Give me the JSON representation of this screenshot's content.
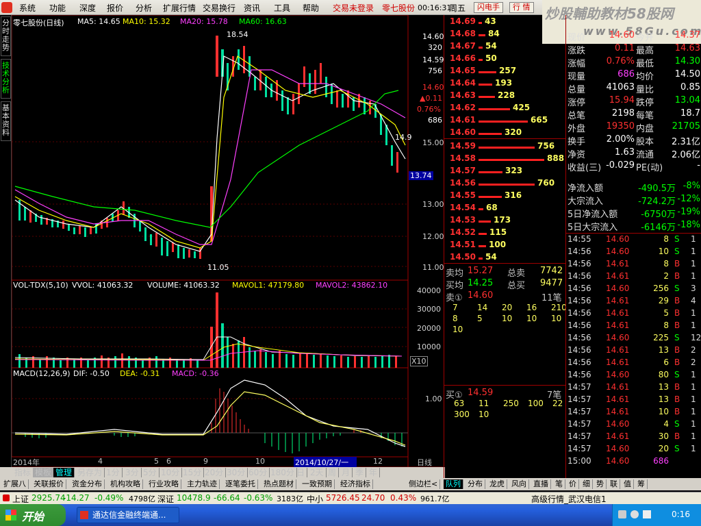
{
  "menu": {
    "items": [
      "系统",
      "功能",
      "深度",
      "报价",
      "分析",
      "扩展行情",
      "交易换行",
      "资讯",
      "工具",
      "帮助"
    ],
    "trade_status": "交易未登录",
    "stock_name_menu": "零七股份",
    "time": "00:16:31",
    "weekday": "周五",
    "flash_btn": "闪电手",
    "quote_btn": "行 情"
  },
  "watermark": {
    "line1": "炒股輔助教材58股网",
    "line2": "www.58Gu.com"
  },
  "left_tabs": [
    "分时走势",
    "技术分析",
    "基本资料"
  ],
  "chart": {
    "title": "零七股份(日线)",
    "ma5": "MA5: 14.65",
    "ma10": "MA10: 15.32",
    "ma20": "MA20: 15.78",
    "ma60": "MA60: 16.63",
    "high_label": "18.54",
    "low_label": "11.05",
    "last_label": "14.9",
    "price_ticks": [
      "14.60",
      "320",
      "14.59",
      "756",
      "14.60",
      "▲0.11",
      "0.76%",
      "686",
      "15.00",
      "13.74",
      "13.00",
      "12.00",
      "11.00"
    ],
    "vol_title": "VOL-TDX(5,10)",
    "vvol": "VVOL: 41063.32",
    "volume": "VOLUME: 41063.32",
    "mavol1": "MAVOL1: 47179.80",
    "mavol2": "MAVOL2: 43862.10",
    "vol_ticks": [
      "40000",
      "30000",
      "20000",
      "10000",
      "X10"
    ],
    "macd_title": "MACD(12,26,9)",
    "dif": "DIF: -0.50",
    "dea": "DEA: -0.31",
    "macd": "MACD: -0.36",
    "macd_tick": "1.00",
    "x_labels": [
      "2014年",
      "4",
      "5",
      "6",
      "9",
      "10",
      "2014/10/27/一",
      "12"
    ],
    "period": "日线"
  },
  "period_tabs": [
    "指标",
    "模板",
    "管理",
    "另存为",
    "1分",
    "3分",
    "5分",
    "10分",
    "15分",
    "20分",
    "30分",
    "60分",
    "180分",
    "日",
    "2天",
    "周",
    "月",
    "季",
    "年"
  ],
  "sell_queue": [
    {
      "p": "14.69",
      "v": "43",
      "w": 4
    },
    {
      "p": "14.68",
      "v": "84",
      "w": 8
    },
    {
      "p": "14.67",
      "v": "54",
      "w": 5
    },
    {
      "p": "14.66",
      "v": "50",
      "w": 5
    },
    {
      "p": "14.65",
      "v": "257",
      "w": 22
    },
    {
      "p": "14.64",
      "v": "193",
      "w": 17
    },
    {
      "p": "14.63",
      "v": "228",
      "w": 20
    },
    {
      "p": "14.62",
      "v": "425",
      "w": 38
    },
    {
      "p": "14.61",
      "v": "665",
      "w": 60
    },
    {
      "p": "14.60",
      "v": "320",
      "w": 28
    }
  ],
  "buy_queue": [
    {
      "p": "14.59",
      "v": "756",
      "w": 68
    },
    {
      "p": "14.58",
      "v": "888",
      "w": 80
    },
    {
      "p": "14.57",
      "v": "323",
      "w": 29
    },
    {
      "p": "14.56",
      "v": "760",
      "w": 68
    },
    {
      "p": "14.55",
      "v": "316",
      "w": 28
    },
    {
      "p": "14.54",
      "v": "68",
      "w": 6
    },
    {
      "p": "14.53",
      "v": "173",
      "w": 15
    },
    {
      "p": "14.52",
      "v": "115",
      "w": 10
    },
    {
      "p": "14.51",
      "v": "100",
      "w": 9
    },
    {
      "p": "14.50",
      "v": "54",
      "w": 5
    }
  ],
  "order_summary": {
    "sell_avg_label": "卖均",
    "sell_avg": "15.27",
    "sell_total_label": "总卖",
    "sell_total": "7742",
    "buy_avg_label": "买均",
    "buy_avg": "14.25",
    "buy_total_label": "总买",
    "buy_total": "9477",
    "sell1_label": "卖①",
    "sell1_price": "14.60",
    "sell1_count": "11笔",
    "sell1_orders": [
      "7",
      "14",
      "20",
      "16",
      "210",
      "8",
      "5",
      "10",
      "10",
      "10",
      "10"
    ],
    "buy1_label": "买①",
    "buy1_price": "14.59",
    "buy1_count": "7笔",
    "buy1_orders": [
      "63",
      "11",
      "250",
      "100",
      "22",
      "300",
      "10"
    ]
  },
  "stats": [
    [
      "现价",
      "14.60",
      "今开",
      "14.37"
    ],
    [
      "涨跌",
      "0.11",
      "最高",
      "14.63"
    ],
    [
      "涨幅",
      "0.76%",
      "最低",
      "14.30"
    ],
    [
      "现量",
      "686",
      "均价",
      "14.50"
    ],
    [
      "总量",
      "41063",
      "量比",
      "0.85"
    ],
    [
      "涨停",
      "15.94",
      "跌停",
      "13.04"
    ],
    [
      "总笔",
      "2198",
      "每笔",
      "18.7"
    ],
    [
      "外盘",
      "19350",
      "内盘",
      "21705"
    ],
    [
      "换手",
      "2.00%",
      "股本",
      "2.31亿"
    ],
    [
      "净资",
      "1.63",
      "流通",
      "2.06亿"
    ],
    [
      "收益(三)",
      "-0.029",
      "PE(动)",
      "-"
    ]
  ],
  "flows": [
    [
      "净流入额",
      "-490.5万",
      "-8%"
    ],
    [
      "大宗流入",
      "-724.2万",
      "-12%"
    ],
    [
      "5日净流入额",
      "-6750万",
      "-19%"
    ],
    [
      "5日大宗流入",
      "-6146万",
      "-18%"
    ]
  ],
  "ticks": [
    [
      "14:55",
      "14.60",
      "8",
      "S",
      "1"
    ],
    [
      "14:56",
      "14.60",
      "10",
      "S",
      "1"
    ],
    [
      "14:56",
      "14.61",
      "8",
      "B",
      "1"
    ],
    [
      "14:56",
      "14.61",
      "2",
      "B",
      "1"
    ],
    [
      "14:56",
      "14.60",
      "256",
      "S",
      "3"
    ],
    [
      "14:56",
      "14.61",
      "29",
      "B",
      "4"
    ],
    [
      "14:56",
      "14.61",
      "5",
      "B",
      "1"
    ],
    [
      "14:56",
      "14.61",
      "8",
      "B",
      "1"
    ],
    [
      "14:56",
      "14.60",
      "225",
      "S",
      "12"
    ],
    [
      "14:56",
      "14.61",
      "13",
      "B",
      "2"
    ],
    [
      "14:56",
      "14.61",
      "6",
      "B",
      "2"
    ],
    [
      "14:56",
      "14.60",
      "80",
      "S",
      "1"
    ],
    [
      "14:57",
      "14.61",
      "13",
      "B",
      "1"
    ],
    [
      "14:57",
      "14.61",
      "13",
      "B",
      "1"
    ],
    [
      "14:57",
      "14.61",
      "10",
      "B",
      "1"
    ],
    [
      "14:57",
      "14.60",
      "4",
      "S",
      "1"
    ],
    [
      "14:57",
      "14.61",
      "30",
      "B",
      "1"
    ],
    [
      "14:57",
      "14.60",
      "20",
      "S",
      "1"
    ],
    [
      "15:00",
      "14.60",
      "686",
      "",
      ""
    ]
  ],
  "bottom_tabs": [
    "扩展八",
    "关联报价",
    "资金分布",
    "机构攻略",
    "行业攻略",
    "主力轨迹",
    "逐笔委托",
    "热点题材",
    "一致预期",
    "经济指标"
  ],
  "side_bar_label": "侧边栏<",
  "right_tabs": [
    "队列",
    "分布",
    "龙虎",
    "风向",
    "直播",
    "笔",
    "价",
    "细",
    "势",
    "联",
    "值",
    "筹"
  ],
  "statusbar": {
    "sh_label": "上证",
    "sh": "2925.74",
    "sh_chg": "-14.27",
    "sh_pct": "-0.49%",
    "sh_amt": "4798亿",
    "sz_label": "深证",
    "sz": "10478.9",
    "sz_chg": "-66.64",
    "sz_pct": "-0.63%",
    "sz_amt": "3183亿",
    "zx_label": "中小",
    "zx": "5726.45",
    "zx_chg": "24.70",
    "zx_pct": "0.43%",
    "zx_amt": "961.7亿",
    "server": "高级行情_武汉电信1"
  },
  "taskbar": {
    "start": "开始",
    "task": "通达信金融终端通...",
    "clock": "0:16"
  }
}
